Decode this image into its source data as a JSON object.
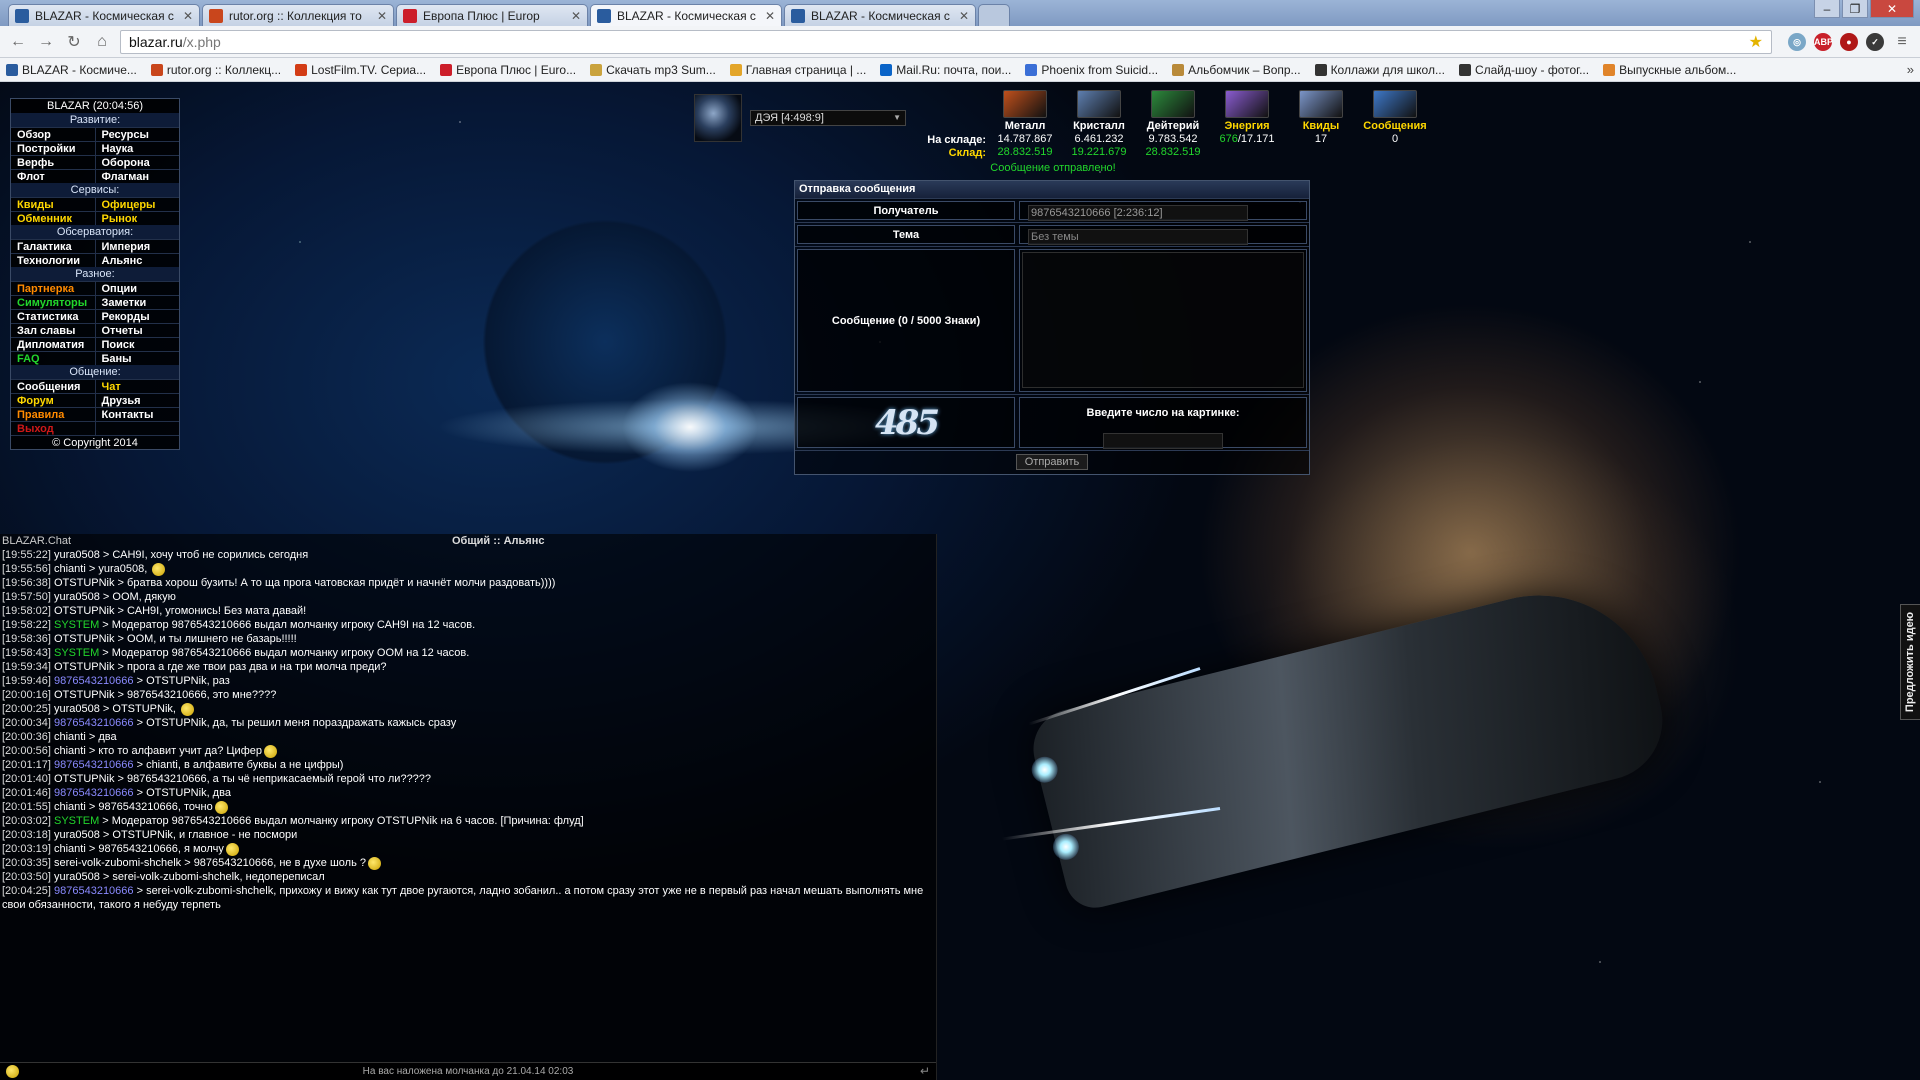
{
  "browser": {
    "tabs": [
      {
        "title": "BLAZAR - Космическая с",
        "fav": "#2a5c9e",
        "active": false
      },
      {
        "title": "rutor.org :: Коллекция то",
        "fav": "#c9461c",
        "active": false
      },
      {
        "title": "Европа Плюс | Europ",
        "fav": "#cc1e2a",
        "active": false
      },
      {
        "title": "BLAZAR - Космическая с",
        "fav": "#2a5c9e",
        "active": true
      },
      {
        "title": "BLAZAR - Космическая с",
        "fav": "#2a5c9e",
        "active": false
      }
    ],
    "url_host": "blazar.ru",
    "url_path": "/x.php",
    "bookmarks": [
      {
        "label": "BLAZAR - Космиче...",
        "color": "#2a5c9e"
      },
      {
        "label": "rutor.org :: Коллекц...",
        "color": "#c9461c"
      },
      {
        "label": "LostFilm.TV. Сериа...",
        "color": "#d33c16"
      },
      {
        "label": "Европа Плюс | Euro...",
        "color": "#cc1e2a"
      },
      {
        "label": "Скачать mp3 Sum...",
        "color": "#caa33e"
      },
      {
        "label": "Главная страница | ...",
        "color": "#e3a52a"
      },
      {
        "label": "Mail.Ru: почта, пои...",
        "color": "#0a64c8"
      },
      {
        "label": "Phoenix from Suicid...",
        "color": "#3a6ed6"
      },
      {
        "label": "Альбомчик – Вопр...",
        "color": "#b98a3a"
      },
      {
        "label": "Коллажи для школ...",
        "color": "#333333"
      },
      {
        "label": "Слайд-шоу - фотог...",
        "color": "#333333"
      },
      {
        "label": "Выпускные альбом...",
        "color": "#e0842a"
      }
    ],
    "bookmarks_more": "»"
  },
  "menu": {
    "header": "BLAZAR (20:04:56)",
    "sections": [
      {
        "title": "Развитие:",
        "rows": [
          [
            {
              "label": "Обзор",
              "cls": "c-white"
            },
            {
              "label": "Ресурсы",
              "cls": "c-white"
            }
          ],
          [
            {
              "label": "Постройки",
              "cls": "c-white"
            },
            {
              "label": "Наука",
              "cls": "c-white"
            }
          ],
          [
            {
              "label": "Верфь",
              "cls": "c-white"
            },
            {
              "label": "Оборона",
              "cls": "c-white"
            }
          ],
          [
            {
              "label": "Флот",
              "cls": "c-white"
            },
            {
              "label": "Флагман",
              "cls": "c-white"
            }
          ]
        ]
      },
      {
        "title": "Сервисы:",
        "rows": [
          [
            {
              "label": "Квиды",
              "cls": "c-yellow"
            },
            {
              "label": "Офицеры",
              "cls": "c-yellow"
            }
          ],
          [
            {
              "label": "Обменник",
              "cls": "c-yellow"
            },
            {
              "label": "Рынок",
              "cls": "c-yellow"
            }
          ]
        ]
      },
      {
        "title": "Обсерватория:",
        "rows": [
          [
            {
              "label": "Галактика",
              "cls": "c-white"
            },
            {
              "label": "Империя",
              "cls": "c-white"
            }
          ],
          [
            {
              "label": "Технологии",
              "cls": "c-white"
            },
            {
              "label": "Альянс",
              "cls": "c-white"
            }
          ]
        ]
      },
      {
        "title": "Разное:",
        "rows": [
          [
            {
              "label": "Партнерка",
              "cls": "c-orange"
            },
            {
              "label": "Опции",
              "cls": "c-white"
            }
          ],
          [
            {
              "label": "Симуляторы",
              "cls": "c-green"
            },
            {
              "label": "Заметки",
              "cls": "c-white"
            }
          ],
          [
            {
              "label": "Статистика",
              "cls": "c-white"
            },
            {
              "label": "Рекорды",
              "cls": "c-white"
            }
          ],
          [
            {
              "label": "Зал славы",
              "cls": "c-white"
            },
            {
              "label": "Отчеты",
              "cls": "c-white"
            }
          ],
          [
            {
              "label": "Дипломатия",
              "cls": "c-white"
            },
            {
              "label": "Поиск",
              "cls": "c-white"
            }
          ],
          [
            {
              "label": "FAQ",
              "cls": "c-green"
            },
            {
              "label": "Баны",
              "cls": "c-white"
            }
          ]
        ]
      },
      {
        "title": "Общение:",
        "rows": [
          [
            {
              "label": "Сообщения",
              "cls": "c-white"
            },
            {
              "label": "Чат",
              "cls": "c-yellow"
            }
          ],
          [
            {
              "label": "Форум",
              "cls": "c-yellow"
            },
            {
              "label": "Друзья",
              "cls": "c-white"
            }
          ],
          [
            {
              "label": "Правила",
              "cls": "c-orange"
            },
            {
              "label": "Контакты",
              "cls": "c-white"
            }
          ],
          [
            {
              "label": "Выход",
              "cls": "c-red"
            },
            {
              "label": "",
              "cls": "c-white"
            }
          ]
        ]
      }
    ],
    "copyright": "© Copyright 2014"
  },
  "planet": {
    "selected": "ДЭЯ [4:498:9]"
  },
  "resources": {
    "label_stock": "На складе:",
    "label_storage": "Склад:",
    "items": [
      {
        "name": "Металл",
        "name_color": "#ffffff",
        "stock": "14.787.867",
        "storage": "28.832.519",
        "icon": "#c0501c"
      },
      {
        "name": "Кристалл",
        "name_color": "#ffffff",
        "stock": "6.461.232",
        "storage": "19.221.679",
        "icon": "#5e7fb0"
      },
      {
        "name": "Дейтерий",
        "name_color": "#ffffff",
        "stock": "9.783.542",
        "storage": "28.832.519",
        "icon": "#2c8a3c"
      },
      {
        "name": "Энергия",
        "name_color": "#ffd800",
        "stock_a": "676",
        "stock_b": "/17.171",
        "storage": "",
        "icon": "#8a5cd0"
      },
      {
        "name": "Квиды",
        "name_color": "#ffd800",
        "stock": "17",
        "storage": "",
        "icon": "#7b95c8"
      },
      {
        "name": "Сообщения",
        "name_color": "#ffd800",
        "stock": "0",
        "storage": "",
        "icon": "#3e78c8"
      }
    ],
    "notice": "Сообщение отправлено!"
  },
  "form": {
    "title": "Отправка сообщения",
    "recipient_label": "Получатель",
    "recipient_value": "9876543210666 [2:236:12]",
    "subject_label": "Тема",
    "subject_placeholder": "Без темы",
    "message_label": "Сообщение (0 / 5000 Знаки)",
    "captcha_text": "485",
    "captcha_label": "Введите число на картинке:",
    "send_label": "Отправить"
  },
  "chat": {
    "title": "BLAZAR.Chat",
    "tabs": "Общий :: Альянс",
    "lines": [
      {
        "t": "[19:55:22]",
        "n": "yura0508",
        "nc": "",
        "m": " > САН9І, хочу чтоб не сорились сегодня",
        "s": false
      },
      {
        "t": "[19:55:56]",
        "n": "chianti",
        "nc": "",
        "m": " > yura0508, ",
        "s": true
      },
      {
        "t": "[19:56:38]",
        "n": "OTSTUPNik",
        "nc": "",
        "m": " > братва хорош бузить! А то ща прога чатовская придёт и начнёт молчи раздовать))))",
        "s": false
      },
      {
        "t": "[19:57:50]",
        "n": "yura0508",
        "nc": "",
        "m": " > OOM, дякую",
        "s": false
      },
      {
        "t": "[19:58:02]",
        "n": "OTSTUPNik",
        "nc": "",
        "m": " > САН9І, угомонись! Без мата давай!",
        "s": false
      },
      {
        "t": "[19:58:22]",
        "n": "SYSTEM",
        "nc": "nick-sys",
        "m": " > Модератор 9876543210666 выдал молчанку игроку САН9І на 12 часов.",
        "s": false
      },
      {
        "t": "[19:58:36]",
        "n": "OTSTUPNik",
        "nc": "",
        "m": " > OOM, и ты лишнего не базарь!!!!!",
        "s": false
      },
      {
        "t": "[19:58:43]",
        "n": "SYSTEM",
        "nc": "nick-sys",
        "m": " > Модератор 9876543210666 выдал молчанку игроку OOM на 12 часов.",
        "s": false
      },
      {
        "t": "[19:59:34]",
        "n": "OTSTUPNik",
        "nc": "",
        "m": " > прога а где же твои раз два и на три молча преди?",
        "s": false
      },
      {
        "t": "[19:59:46]",
        "n": "9876543210666",
        "nc": "nick-mod",
        "m": " > OTSTUPNik, раз",
        "s": false
      },
      {
        "t": "[20:00:16]",
        "n": "OTSTUPNik",
        "nc": "",
        "m": " > 9876543210666, это мне????",
        "s": false
      },
      {
        "t": "[20:00:25]",
        "n": "yura0508",
        "nc": "",
        "m": " > OTSTUPNik, ",
        "s": true
      },
      {
        "t": "[20:00:34]",
        "n": "9876543210666",
        "nc": "nick-mod",
        "m": " > OTSTUPNik, да, ты решил меня пораздражать кажысь сразу",
        "s": false
      },
      {
        "t": "[20:00:36]",
        "n": "chianti",
        "nc": "",
        "m": " > два",
        "s": false
      },
      {
        "t": "[20:00:56]",
        "n": "chianti",
        "nc": "",
        "m": " > кто то алфавит учит  да? Цифер",
        "s": true
      },
      {
        "t": "[20:01:17]",
        "n": "9876543210666",
        "nc": "nick-mod",
        "m": " > chianti, в алфавите буквы а не цифры)",
        "s": false
      },
      {
        "t": "[20:01:40]",
        "n": "OTSTUPNik",
        "nc": "",
        "m": " > 9876543210666, а ты чё неприкасаемый герой что ли?????",
        "s": false
      },
      {
        "t": "[20:01:46]",
        "n": "9876543210666",
        "nc": "nick-mod",
        "m": " > OTSTUPNik, два",
        "s": false
      },
      {
        "t": "[20:01:55]",
        "n": "chianti",
        "nc": "",
        "m": " > 9876543210666,  точно",
        "s": true
      },
      {
        "t": "[20:03:02]",
        "n": "SYSTEM",
        "nc": "nick-sys",
        "m": " > Модератор 9876543210666 выдал молчанку игроку OTSTUPNik на 6 часов. [Причина: флуд]",
        "s": false
      },
      {
        "t": "[20:03:18]",
        "n": "yura0508",
        "nc": "",
        "m": " > OTSTUPNik, и главное - не посмори",
        "s": false
      },
      {
        "t": "[20:03:19]",
        "n": "chianti",
        "nc": "",
        "m": " > 9876543210666,  я молчу",
        "s": true
      },
      {
        "t": "[20:03:35]",
        "n": "serei-volk-zubomi-shchelk",
        "nc": "",
        "m": " > 9876543210666, не в духе шоль ?",
        "s": true
      },
      {
        "t": "[20:03:50]",
        "n": "yura0508",
        "nc": "",
        "m": " > serei-volk-zubomi-shchelk, недопереписал",
        "s": false
      },
      {
        "t": "[20:04:25]",
        "n": "9876543210666",
        "nc": "nick-mod",
        "m": " > serei-volk-zubomi-shchelk, прихожу и вижу как тут двое ругаются, ладно зобанил.. а потом сразу этот уже не в первый раз начал мешать выполнять мне свои обязанности, такого я небуду терпеть",
        "s": false
      }
    ],
    "footer": "На вас наложена молчанка до 21.04.14 02:03"
  },
  "side_tab": "Предложить идею"
}
